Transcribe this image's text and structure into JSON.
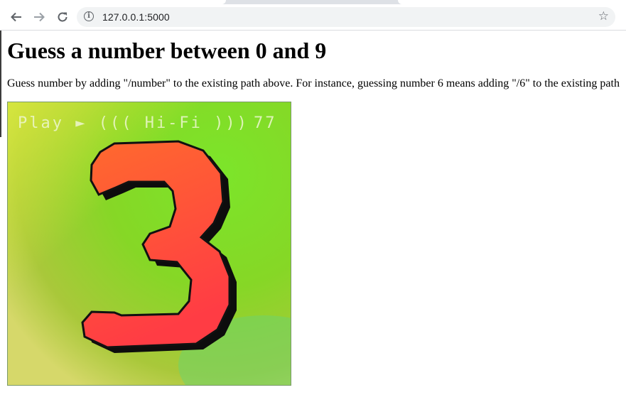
{
  "browser": {
    "url": "127.0.0.1:5000"
  },
  "page": {
    "heading": "Guess a number between 0 and 9",
    "instructions": "Guess number by adding \"/number\" to the existing path above. For instance, guessing number 6 means adding \"/6\" to the existing path",
    "image": {
      "hud_left": "Play ► ((( Hi-Fi )))",
      "hud_right": "77",
      "digit": "3",
      "colors": {
        "background_light": "#c9e13a",
        "background_green": "#7ddf2a",
        "digit_fill": "#ff4a3a",
        "digit_shadow": "#111111",
        "hud_text": "#e8f5c8"
      }
    }
  }
}
